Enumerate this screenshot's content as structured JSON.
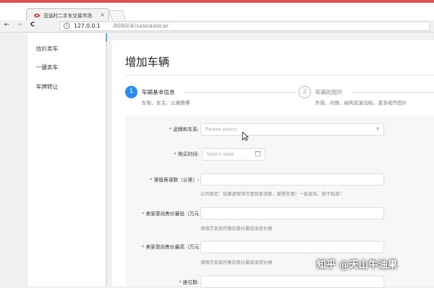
{
  "browser": {
    "tab_title": "亚运村二手车交易市场",
    "tab_close": "×",
    "url_host": "127.0.0.1",
    "url_path": ":8080/#/sale/addcar",
    "nav_back": "←",
    "nav_forward": "→",
    "nav_reload": "C"
  },
  "sidebar": {
    "items": [
      {
        "label": "估价卖车"
      },
      {
        "label": "一键卖车"
      },
      {
        "label": "车牌转让"
      }
    ]
  },
  "page": {
    "title": "增加车辆"
  },
  "steps": [
    {
      "number": "1",
      "title": "车辆基本信息",
      "desc": "车型、车主、公里数等",
      "active": true
    },
    {
      "number": "2",
      "title": "车辆的图片",
      "desc": "外观、内饰、结构及发动机、更多细节图片",
      "active": false
    }
  ],
  "form": {
    "brand": {
      "label": "品牌和车系:",
      "placeholder": "Please select"
    },
    "buy_time": {
      "label": "购买时间:",
      "placeholder": "Select date"
    },
    "mileage": {
      "label": "里程表读数（公里）:",
      "hint": "公司规定：如果虚假填写里程表读数，报警处理！一经发现，绝不姑息！"
    },
    "price_min": {
      "label": "卖家意向售价最低（万元",
      "hint": "请填写卖家的意向售价最低承受价格"
    },
    "price_max": {
      "label": "卖家意向售价最高（万元",
      "hint": "请填写卖家的意向售价最高承受价格"
    },
    "seats": {
      "label": "座位数:"
    }
  },
  "watermark": "知乎 @天山牛油果",
  "colors": {
    "accent": "#2d8cf0",
    "required": "#e33333",
    "top_bar": "#d9534f"
  }
}
